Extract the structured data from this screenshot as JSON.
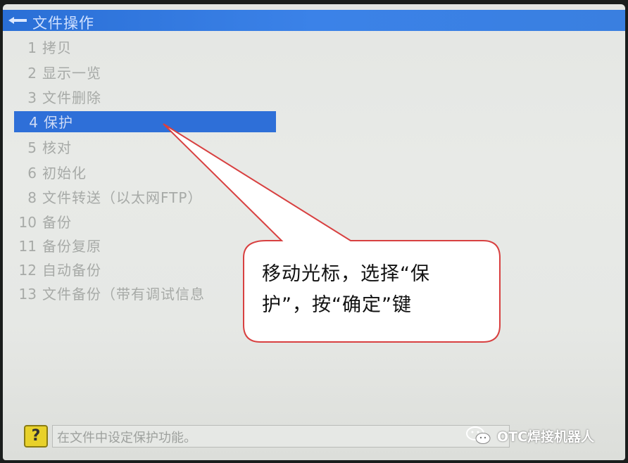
{
  "window": {
    "title": "文件操作"
  },
  "menu": {
    "items": [
      {
        "num": "1",
        "label": "拷贝"
      },
      {
        "num": "2",
        "label": "显示一览"
      },
      {
        "num": "3",
        "label": "文件删除"
      },
      {
        "num": "4",
        "label": "保护",
        "selected": true
      },
      {
        "num": "5",
        "label": "核对"
      },
      {
        "num": "6",
        "label": "初始化"
      },
      {
        "num": "8",
        "label": "文件转送（以太网FTP）"
      },
      {
        "num": "10",
        "label": "备份"
      },
      {
        "num": "11",
        "label": "备份复原"
      },
      {
        "num": "12",
        "label": "自动备份"
      },
      {
        "num": "13",
        "label": "文件备份（带有调试信息"
      }
    ]
  },
  "callout": {
    "line1": "移动光标，选择“保",
    "line2": "护”，按“确定”键"
  },
  "status": {
    "icon_glyph": "?",
    "message": "在文件中设定保护功能。"
  },
  "watermark": {
    "text": "OTC焊接机器人"
  },
  "colors": {
    "title_bar": "#3b82e8",
    "selection": "#2e6fd8",
    "callout_border": "#d84040",
    "help_icon": "#e8d12a"
  }
}
